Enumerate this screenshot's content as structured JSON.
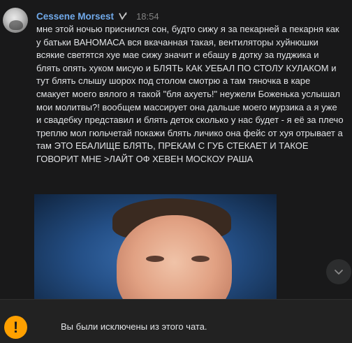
{
  "message": {
    "author": "Cessene Morsest",
    "time": "18:54",
    "text": "мне этой ночью приснился сон, будто сижу я за пекарней а пекарня как у батьки ВАНОМАСА вся вкачанная такая, вентиляторы хуйнюшки всякие светятся хуе мае сижу значит и ебашу в дотку за пуджика и блять опять хуком мисую и БЛЯТЬ КАК УЕБАЛ ПО СТОЛУ КУЛАКОМ и тут блять слышу шорох под столом смотрю а там тяночка в каре смакует моего вялого я такой \"бля ахуеть!\" неужели Боженька услышал мои молитвы?! вообщем массирует она дальше моего мурзика а я уже и свадебку представил и блять деток сколько у нас будет - я её за плечо треплю мол гюльчетай покажи блять личико она фейс от хуя отрывает а там ЭТО ЕБАЛИЩЕ БЛЯТЬ, ПРЕКАМ С ГУБ СТЕКАЕТ И ТАКОЕ ГОВОРИТ МНЕ >ЛАЙТ ОФ ХЕВЕН МОСКОУ РАША"
  },
  "footer": {
    "notice": "Вы были исключены из этого чата.",
    "icon": "exclamation-icon"
  },
  "icons": {
    "badge": "verified-badge-icon",
    "scroll": "chevron-down-icon"
  },
  "colors": {
    "background": "#19191a",
    "author": "#71aaeb",
    "warning": "#ffa000",
    "footer": "#222222"
  }
}
